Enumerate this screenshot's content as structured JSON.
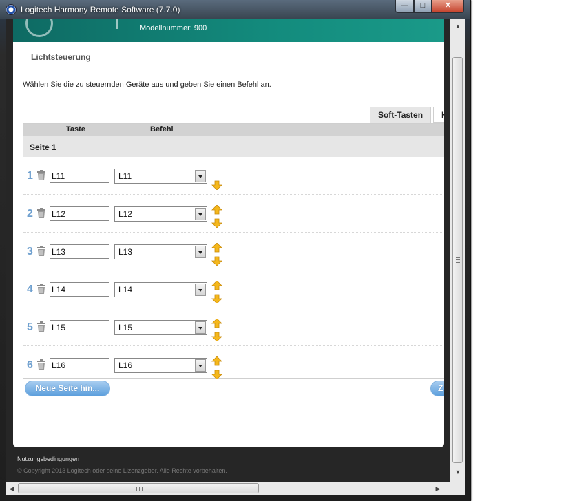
{
  "window": {
    "title": "Logitech Harmony Remote Software (7.7.0)",
    "minimize_glyph": "—",
    "maximize_glyph": "□",
    "close_glyph": "✕"
  },
  "header": {
    "model_number": "Modellnummer: 900"
  },
  "page": {
    "section_title": "Lichtsteuerung",
    "instruction": "Wählen Sie die zu steuernden Geräte aus und geben Sie einen Befehl an."
  },
  "tabs": [
    {
      "label": "Soft-Tasten",
      "selected": true
    },
    {
      "label": "H",
      "selected": false
    }
  ],
  "table": {
    "col_key": "Taste",
    "col_command": "Befehl",
    "page_label": "Seite 1",
    "rows": [
      {
        "number": "1",
        "key": "L11",
        "command": "L11",
        "up": false,
        "down": true
      },
      {
        "number": "2",
        "key": "L12",
        "command": "L12",
        "up": true,
        "down": true
      },
      {
        "number": "3",
        "key": "L13",
        "command": "L13",
        "up": true,
        "down": true
      },
      {
        "number": "4",
        "key": "L14",
        "command": "L14",
        "up": true,
        "down": true
      },
      {
        "number": "5",
        "key": "L15",
        "command": "L15",
        "up": true,
        "down": true
      },
      {
        "number": "6",
        "key": "L16",
        "command": "L16",
        "up": true,
        "down": true
      }
    ]
  },
  "buttons": {
    "new_page": "Neue Seite hin...",
    "partial_right": "Z"
  },
  "footer": {
    "terms": "Nutzungsbedingungen",
    "copyright": "© Copyright 2013 Logitech oder seine Lizenzgeber. Alle Rechte vorbehalten."
  },
  "scrollbars": {
    "up_glyph": "▲",
    "down_glyph": "▼",
    "left_glyph": "◀",
    "right_glyph": "▶"
  },
  "colors": {
    "header_teal": "#138b7d",
    "row_number_blue": "#6fa0cf",
    "arrow_yellow": "#f5b81c",
    "button_blue": "#5c9fdd"
  },
  "icons": {
    "row_delete": "trash-icon",
    "move_up": "arrow-up-icon",
    "move_down": "arrow-down-icon",
    "dropdown": "chevron-down-icon"
  }
}
